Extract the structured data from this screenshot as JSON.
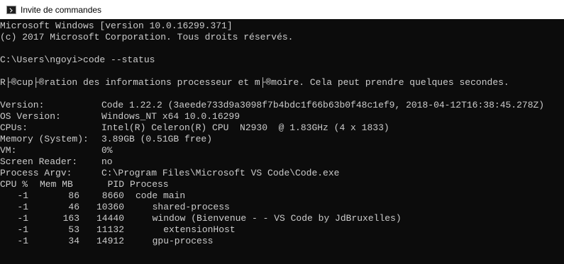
{
  "window": {
    "title": "Invite de commandes",
    "icon": "cmd-icon"
  },
  "console": {
    "banner_line1": "Microsoft Windows [version 10.0.16299.371]",
    "banner_line2": "(c) 2017 Microsoft Corporation. Tous droits réservés.",
    "prompt_command": "C:\\Users\\ngoyi>code --status",
    "retrieving_message": "R├®cup├®ration des informations processeur et m├®moire. Cela peut prendre quelques secondes.",
    "info": [
      {
        "key": "Version:",
        "value": "Code 1.22.2 (3aeede733d9a3098f7b4bdc1f66b63b0f48c1ef9, 2018-04-12T16:38:45.278Z)"
      },
      {
        "key": "OS Version:",
        "value": "Windows_NT x64 10.0.16299"
      },
      {
        "key": "CPUs:",
        "value": "Intel(R) Celeron(R) CPU  N2930  @ 1.83GHz (4 x 1833)"
      },
      {
        "key": "Memory (System):",
        "value": "3.89GB (0.51GB free)"
      },
      {
        "key": "VM:",
        "value": "0%"
      },
      {
        "key": "Screen Reader:",
        "value": "no"
      },
      {
        "key": "Process Argv:",
        "value": "C:\\Program Files\\Microsoft VS Code\\Code.exe"
      }
    ],
    "process_table": {
      "headers": {
        "cpu": "CPU %",
        "mem": "Mem MB",
        "pid": "PID",
        "process": "Process"
      },
      "rows": [
        {
          "cpu": "-1",
          "mem": "86",
          "pid": "8660",
          "process": "code main"
        },
        {
          "cpu": "-1",
          "mem": "46",
          "pid": "10360",
          "process": "  shared-process"
        },
        {
          "cpu": "-1",
          "mem": "163",
          "pid": "14440",
          "process": "  window (Bienvenue - - VS Code by JdBruxelles)"
        },
        {
          "cpu": "-1",
          "mem": "53",
          "pid": "11132",
          "process": "    extensionHost"
        },
        {
          "cpu": "-1",
          "mem": "34",
          "pid": "14912",
          "process": "  gpu-process"
        }
      ]
    }
  },
  "colors": {
    "console_bg": "#0c0c0c",
    "console_fg": "#cccccc",
    "titlebar_bg": "#ffffff"
  }
}
